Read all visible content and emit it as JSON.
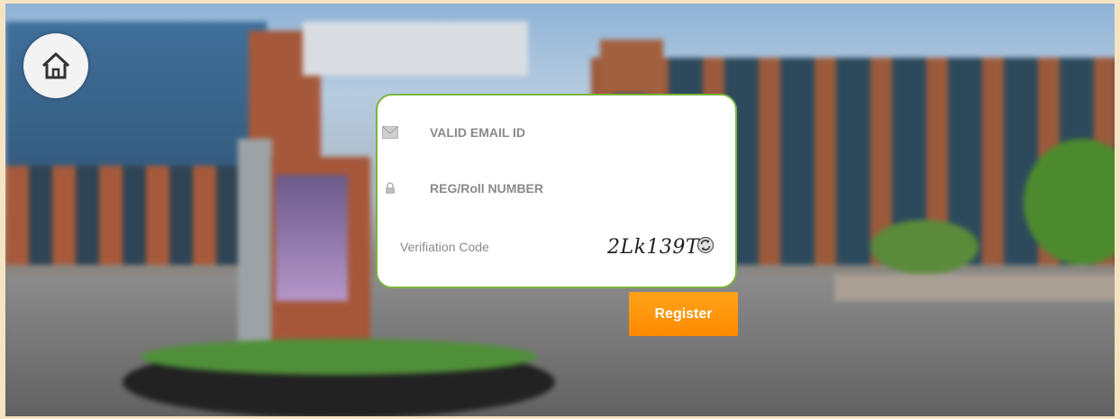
{
  "form": {
    "email_placeholder": "VALID EMAIL ID",
    "reg_placeholder": "REG/Roll NUMBER",
    "verification_label": "Verifiation Code",
    "captcha_text": "2Lk139T",
    "register_label": "Register"
  },
  "icons": {
    "home": "home-icon",
    "email": "envelope-icon",
    "reg": "lock-icon",
    "refresh": "refresh-icon"
  },
  "colors": {
    "card_border": "#7cb342",
    "register_button": "#ff9800"
  }
}
